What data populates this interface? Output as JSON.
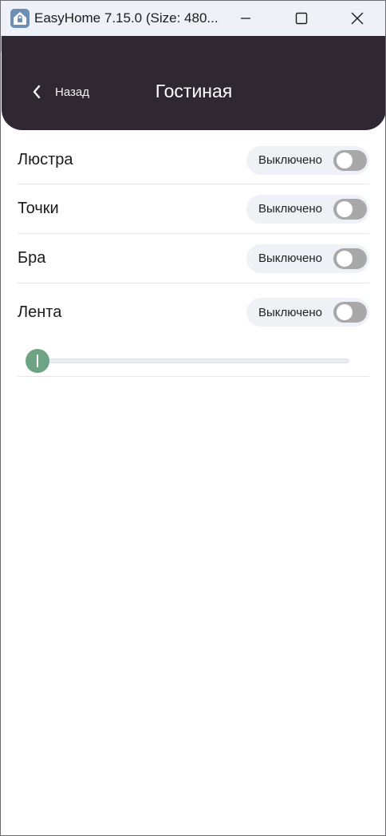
{
  "window": {
    "title": "EasyHome 7.15.0 (Size: 480...",
    "app_icon": "home-lock-icon"
  },
  "header": {
    "back_label": "Назад",
    "title": "Гостиная"
  },
  "devices": [
    {
      "label": "Люстра",
      "state": "Выключено",
      "on": false
    },
    {
      "label": "Точки",
      "state": "Выключено",
      "on": false
    },
    {
      "label": "Бра",
      "state": "Выключено",
      "on": false
    },
    {
      "label": "Лента",
      "state": "Выключено",
      "on": false,
      "brightness": 0
    }
  ],
  "colors": {
    "header_bg": "#2f2833",
    "slider_thumb": "#6ea384",
    "switch_off": "#a8a8a8"
  }
}
